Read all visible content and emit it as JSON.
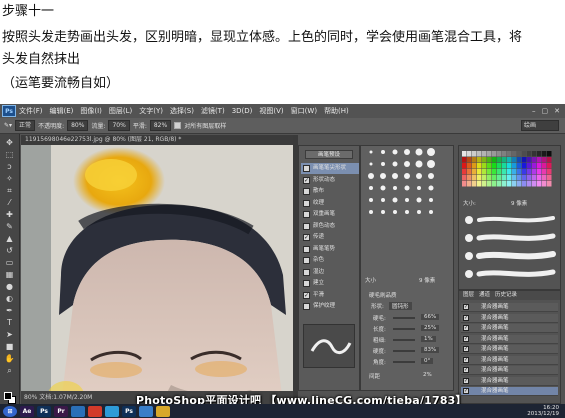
{
  "doc": {
    "heading": "步骤十一",
    "para1": "按照头发走势画出头发，区别明暗，显现立体感。上色的同时，学会使用画笔混合工具，将",
    "para2": "头发自然抹出",
    "note": "（运笔要流畅自如）"
  },
  "app": {
    "logo": "Ps",
    "menu": [
      "文件(F)",
      "编辑(E)",
      "图像(I)",
      "图层(L)",
      "文字(Y)",
      "选择(S)",
      "滤镜(T)",
      "3D(D)",
      "视图(V)",
      "窗口(W)",
      "帮助(H)"
    ],
    "window_controls": [
      "–",
      "▢",
      "✕"
    ]
  },
  "options": {
    "mode": "正常",
    "opacity_label": "不透明度:",
    "opacity": "80%",
    "flow_label": "流量:",
    "flow": "70%",
    "smooth_label": "平滑:",
    "smooth": "82%",
    "sample_label": "对所有图层取样",
    "workspace": "绘画"
  },
  "document": {
    "tab": "11915698046e22753l.jpg @ 80% (图层 21, RGB/8) *",
    "status": "80%    文档:1.07M/2.20M"
  },
  "brush_panel": {
    "preset_button": "画笔预设",
    "items": [
      {
        "label": "画笔笔尖形状",
        "checked": false,
        "selected": true
      },
      {
        "label": "形状动态",
        "checked": true,
        "selected": false
      },
      {
        "label": "散布",
        "checked": false,
        "selected": false
      },
      {
        "label": "纹理",
        "checked": false,
        "selected": false
      },
      {
        "label": "双重画笔",
        "checked": false,
        "selected": false
      },
      {
        "label": "颜色动态",
        "checked": false,
        "selected": false
      },
      {
        "label": "传递",
        "checked": true,
        "selected": false
      },
      {
        "label": "画笔笔势",
        "checked": false,
        "selected": false
      },
      {
        "label": "杂色",
        "checked": false,
        "selected": false
      },
      {
        "label": "湿边",
        "checked": false,
        "selected": false
      },
      {
        "label": "建立",
        "checked": false,
        "selected": false
      },
      {
        "label": "平滑",
        "checked": true,
        "selected": false
      },
      {
        "label": "保护纹理",
        "checked": false,
        "selected": false
      }
    ]
  },
  "brush_tips": {
    "size_label": "大小",
    "size_value": "9 像素",
    "bristle_label": "硬毛刷品质",
    "shape_label": "形状:",
    "shape_value": "圆钝形",
    "params": [
      {
        "label": "硬毛:",
        "value": "66%"
      },
      {
        "label": "长度:",
        "value": "25%"
      },
      {
        "label": "粗细:",
        "value": "1%"
      },
      {
        "label": "硬度:",
        "value": "83%"
      },
      {
        "label": "角度:",
        "value": "0°"
      }
    ],
    "spacing_label": "间距",
    "spacing_value": "2%"
  },
  "layers_panel": {
    "brush_size_label": "大小:",
    "brush_size_value": "9 像素",
    "tabs": [
      "图层",
      "通道",
      "历史记录"
    ],
    "rows": [
      "混合器画笔",
      "混合器画笔",
      "混合器画笔",
      "混合器画笔",
      "混合器画笔",
      "混合器画笔",
      "混合器画笔",
      "混合器画笔",
      "混合器画笔"
    ]
  },
  "taskbar": {
    "apps": [
      {
        "label": "Ae",
        "color": "#2d1a4d"
      },
      {
        "label": "Ps",
        "color": "#0f2f57"
      },
      {
        "label": "Pr",
        "color": "#3a1848"
      },
      {
        "label": "",
        "color": "#2a6fb8"
      },
      {
        "label": "",
        "color": "#d23a2a"
      },
      {
        "label": "",
        "color": "#2e9bd8"
      },
      {
        "label": "Ps",
        "color": "#0f2f57"
      },
      {
        "label": "",
        "color": "#3a7ec8"
      },
      {
        "label": "",
        "color": "#d8a82a"
      }
    ],
    "time": "16:20",
    "date": "2013/12/19"
  },
  "watermark": "PhotoShop平面设计吧 【www.lineCG.com/tieba/1783】"
}
